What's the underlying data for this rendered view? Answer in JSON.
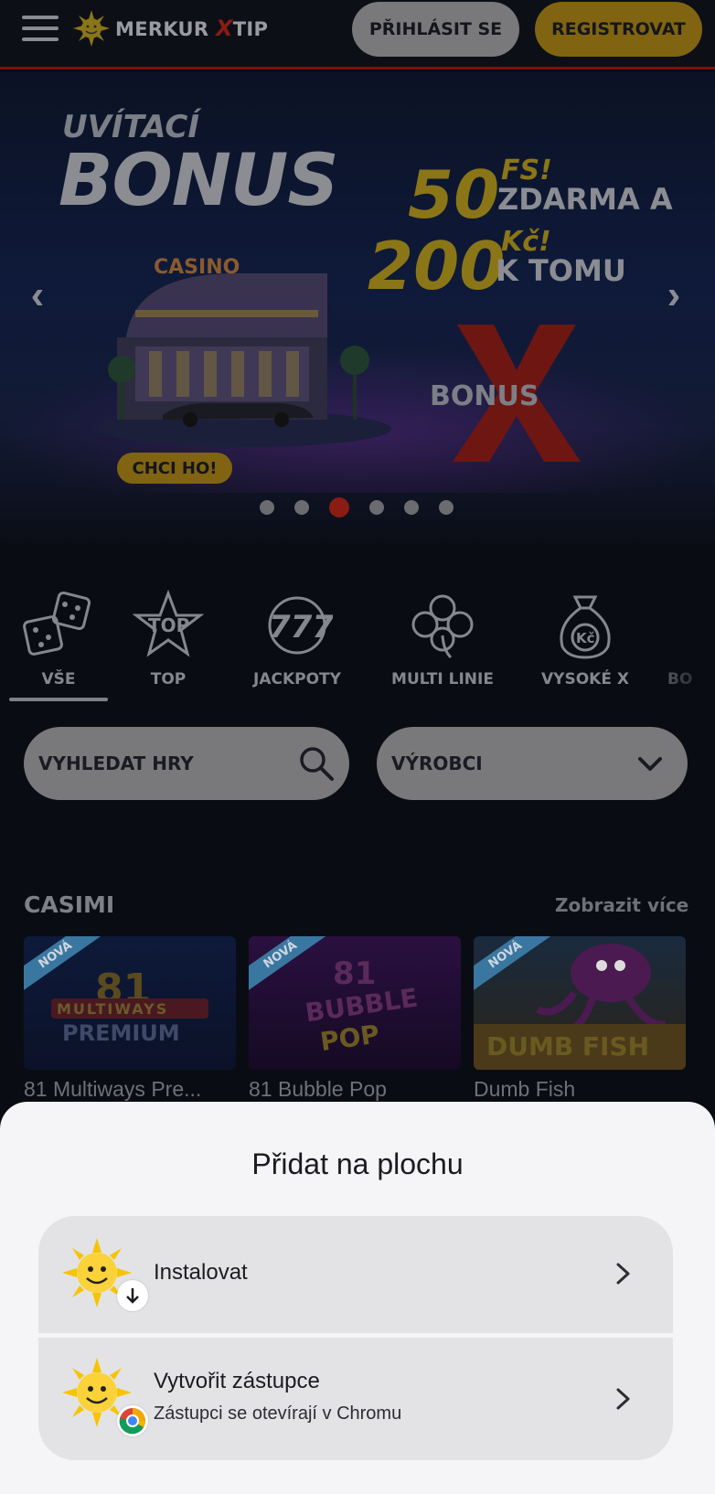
{
  "header": {
    "logo_text": "MERKUR",
    "logo_x": "X",
    "logo_tip": "TIP",
    "login_label": "PŘIHLÁSIT SE",
    "register_label": "REGISTROVAT"
  },
  "banner": {
    "uvitaci": "UVÍTACÍ",
    "bonus": "BONUS",
    "fs_amount": "50",
    "fs_unit": "FS!",
    "fs_text": "ZDARMA A",
    "kc_amount": "200",
    "kc_unit": "Kč!",
    "kc_text": "K TOMU",
    "casino_sign": "CASINO",
    "bonus_x_sign": "BONUS",
    "cta_label": "CHCI HO!",
    "slides_count": 6,
    "active_slide": 3
  },
  "categories": [
    {
      "label": "VŠE",
      "icon": "dice-icon",
      "active": true
    },
    {
      "label": "TOP",
      "icon": "top-star-icon",
      "active": false
    },
    {
      "label": "JACKPOTY",
      "icon": "777-icon",
      "active": false
    },
    {
      "label": "MULTI LINIE",
      "icon": "clover-icon",
      "active": false
    },
    {
      "label": "VYSOKÉ X",
      "icon": "money-bag-icon",
      "active": false
    },
    {
      "label": "BO",
      "icon": "partial-icon",
      "active": false
    }
  ],
  "search": {
    "label": "VYHLEDAT HRY"
  },
  "producers": {
    "label": "VÝROBCI"
  },
  "section": {
    "title": "CASIMI",
    "show_more": "Zobrazit více",
    "badge": "NOVÁ",
    "games": [
      {
        "name": "81 Multiways Pre...",
        "thumb_text": "81 MULTIWAYS PREMIUM"
      },
      {
        "name": "81 Bubble Pop",
        "thumb_text": "81 BUBBLE POP"
      },
      {
        "name": "Dumb Fish",
        "thumb_text": "DUMB FISH"
      }
    ]
  },
  "sheet": {
    "title": "Přidat na plochu",
    "install_label": "Instalovat",
    "shortcut_label": "Vytvořit zástupce",
    "shortcut_sub": "Zástupci se otevírají v Chromu"
  },
  "colors": {
    "accent_gold": "#806412",
    "accent_red": "#8a1c12",
    "sheet_bg": "#f5f5f8",
    "option_bg": "#e3e3e6"
  }
}
